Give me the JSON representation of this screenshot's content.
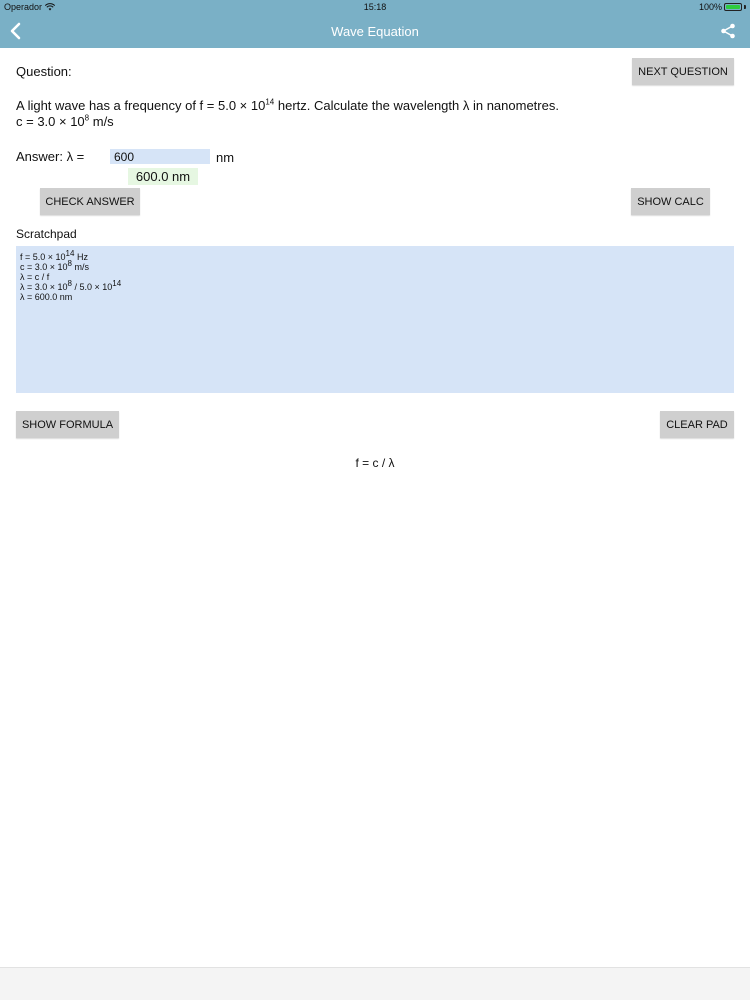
{
  "status_bar": {
    "carrier": "Operador",
    "time": "15:18",
    "battery": "100%",
    "battery_level": 1.0
  },
  "nav": {
    "title": "Wave Equation",
    "back_icon": "chevron-left-icon",
    "share_icon": "share-icon",
    "bar_color": "#7ab0c6"
  },
  "question": {
    "label": "Question:",
    "next_button": "NEXT QUESTION",
    "line1_a": "A light wave has a frequency of f = 5.0 × 10",
    "line1_exp": "14",
    "line1_b": " hertz. Calculate the  wavelength λ in nanometres.",
    "line2_a": "c = 3.0 × 10",
    "line2_exp": "8",
    "line2_b": " m/s"
  },
  "answer": {
    "label": "Answer:  λ =",
    "value": "600",
    "unit": "nm",
    "result": "600.0 nm",
    "check_button": "CHECK ANSWER",
    "calc_button": "SHOW CALC"
  },
  "scratchpad": {
    "label": "Scratchpad",
    "l1_a": "f = 5.0 × 10",
    "l1_exp": "14",
    "l1_b": " Hz",
    "l2_a": "c = 3.0 × 10",
    "l2_exp": "8",
    "l2_b": " m/s",
    "l3": "λ = c / f",
    "l4_a": "λ = 3.0 × 10",
    "l4_exp": "8",
    "l4_b": "  /  5.0 × 10",
    "l4_exp2": "14",
    "l5": "λ = 600.0 nm"
  },
  "footer": {
    "formula_button": "SHOW FORMULA",
    "clear_button": "CLEAR PAD",
    "formula": "f = c / λ"
  },
  "colors": {
    "input_bg": "#d6e4f7",
    "result_bg": "#e6f7e2",
    "button_bg": "#cfcfcf"
  }
}
